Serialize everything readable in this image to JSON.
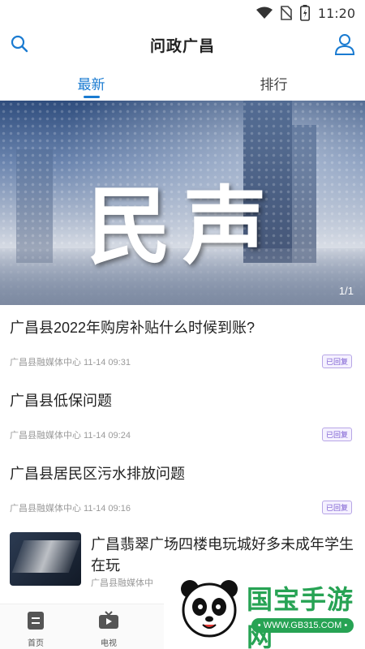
{
  "status_bar": {
    "time": "11:20",
    "icons": [
      "wifi-icon",
      "no-sim-icon",
      "battery-icon"
    ]
  },
  "header": {
    "title": "问政广昌",
    "left_icon": "search-icon",
    "right_icon": "user-icon"
  },
  "tabs": [
    {
      "label": "最新",
      "active": true
    },
    {
      "label": "排行",
      "active": false
    }
  ],
  "banner": {
    "title": "民声",
    "counter": "1/1"
  },
  "news": [
    {
      "title": "广昌县2022年购房补贴什么时候到账?",
      "meta": "广昌县融媒体中心 11-14 09:31",
      "badge": "已回复"
    },
    {
      "title": "广昌县低保问题",
      "meta": "广昌县融媒体中心 11-14 09:24",
      "badge": "已回复"
    },
    {
      "title": "广昌县居民区污水排放问题",
      "meta": "广昌县融媒体中心 11-14 09:16",
      "badge": "已回复"
    },
    {
      "title": "广昌翡翠广场四楼电玩城好多未成年学生在玩",
      "meta": "广昌县融媒体中",
      "thumbnail": "arcade-photo"
    }
  ],
  "bottom_nav": [
    {
      "label": "首页",
      "icon": "home-icon"
    },
    {
      "label": "电视",
      "icon": "tv-icon"
    }
  ],
  "watermark": {
    "text": "国宝手游网",
    "url": "• WWW.GB315.COM •",
    "icon": "panda-icon"
  },
  "colors": {
    "accent": "#1a7bd1",
    "badge": "#7a5bd0",
    "watermark_green": "#27a354"
  }
}
